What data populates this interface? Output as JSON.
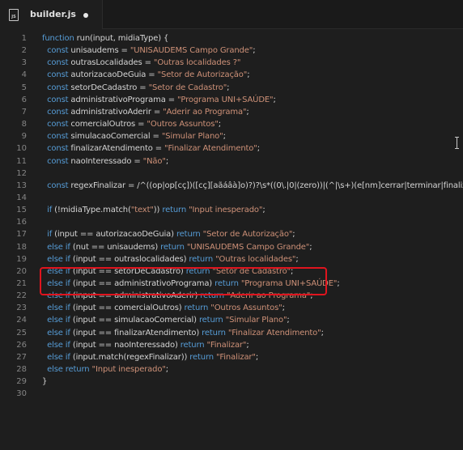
{
  "tab": {
    "title": "builder.js",
    "icon": "js-file-icon",
    "icon_text": "JS",
    "modified": true
  },
  "colors": {
    "keyword": "#569cd6",
    "string": "#ce9178",
    "text": "#d4d4d4",
    "line_number": "#858585",
    "highlight": "#e0141e"
  },
  "lines": [
    {
      "n": "1",
      "parts": [
        [
          "k",
          "function"
        ],
        [
          "v",
          " run(input, midiaType) {"
        ]
      ]
    },
    {
      "n": "2",
      "parts": [
        [
          "v",
          "  "
        ],
        [
          "k",
          "const"
        ],
        [
          "v",
          " unisaudems = "
        ],
        [
          "s",
          "\"UNISAUDEMS Campo Grande\""
        ],
        [
          "v",
          ";"
        ]
      ]
    },
    {
      "n": "3",
      "parts": [
        [
          "v",
          "  "
        ],
        [
          "k",
          "const"
        ],
        [
          "v",
          " outrasLocalidades = "
        ],
        [
          "s",
          "\"Outras localidades ?\""
        ]
      ]
    },
    {
      "n": "4",
      "parts": [
        [
          "v",
          "  "
        ],
        [
          "k",
          "const"
        ],
        [
          "v",
          " autorizacaoDeGuia = "
        ],
        [
          "s",
          "\"Setor de Autorização\""
        ],
        [
          "v",
          ";"
        ]
      ]
    },
    {
      "n": "5",
      "parts": [
        [
          "v",
          "  "
        ],
        [
          "k",
          "const"
        ],
        [
          "v",
          " setorDeCadastro = "
        ],
        [
          "s",
          "\"Setor de Cadastro\""
        ],
        [
          "v",
          ";"
        ]
      ]
    },
    {
      "n": "6",
      "parts": [
        [
          "v",
          "  "
        ],
        [
          "k",
          "const"
        ],
        [
          "v",
          " administrativoPrograma = "
        ],
        [
          "s",
          "\"Programa UNI+SAÚDE\""
        ],
        [
          "v",
          ";"
        ]
      ]
    },
    {
      "n": "7",
      "parts": [
        [
          "v",
          "  "
        ],
        [
          "k",
          "const"
        ],
        [
          "v",
          " administrativoAderir = "
        ],
        [
          "s",
          "\"Aderir ao Programa\""
        ],
        [
          "v",
          ";"
        ]
      ]
    },
    {
      "n": "8",
      "parts": [
        [
          "v",
          "  "
        ],
        [
          "k",
          "const"
        ],
        [
          "v",
          " comercialOutros = "
        ],
        [
          "s",
          "\"Outros Assuntos\""
        ],
        [
          "v",
          ";"
        ]
      ]
    },
    {
      "n": "9",
      "parts": [
        [
          "v",
          "  "
        ],
        [
          "k",
          "const"
        ],
        [
          "v",
          " simulacaoComercial = "
        ],
        [
          "s",
          "\"Simular Plano\""
        ],
        [
          "v",
          ";"
        ]
      ]
    },
    {
      "n": "10",
      "parts": [
        [
          "v",
          "  "
        ],
        [
          "k",
          "const"
        ],
        [
          "v",
          " finalizarAtendimento = "
        ],
        [
          "s",
          "\"Finalizar Atendimento\""
        ],
        [
          "v",
          ";"
        ]
      ]
    },
    {
      "n": "11",
      "parts": [
        [
          "v",
          "  "
        ],
        [
          "k",
          "const"
        ],
        [
          "v",
          " naoInteressado = "
        ],
        [
          "s",
          "\"Não\""
        ],
        [
          "v",
          ";"
        ]
      ]
    },
    {
      "n": "12",
      "parts": []
    },
    {
      "n": "13",
      "parts": [
        [
          "v",
          "  "
        ],
        [
          "k",
          "const"
        ],
        [
          "v",
          " regexFinalizar = /^((op|op[cç])([cç][aãáâà]o)?)?\\s*((0\\.|0|(zero))|(^|\\s+)(e[nm]cerrar|terminar|finaliz"
        ]
      ]
    },
    {
      "n": "14",
      "parts": []
    },
    {
      "n": "15",
      "parts": [
        [
          "v",
          "  "
        ],
        [
          "k",
          "if"
        ],
        [
          "v",
          " (!midiaType.match("
        ],
        [
          "s",
          "\"text\""
        ],
        [
          "v",
          ")) "
        ],
        [
          "k",
          "return"
        ],
        [
          "v",
          " "
        ],
        [
          "s",
          "\"Input inesperado\""
        ],
        [
          "v",
          ";"
        ]
      ]
    },
    {
      "n": "16",
      "parts": []
    },
    {
      "n": "17",
      "parts": [
        [
          "v",
          "  "
        ],
        [
          "k",
          "if"
        ],
        [
          "v",
          " (input == autorizacaoDeGuia) "
        ],
        [
          "k",
          "return"
        ],
        [
          "v",
          " "
        ],
        [
          "s",
          "\"Setor de Autorização\""
        ],
        [
          "v",
          ";"
        ]
      ]
    },
    {
      "n": "18",
      "parts": [
        [
          "v",
          "  "
        ],
        [
          "k",
          "else if"
        ],
        [
          "v",
          " (nut == unisaudems) "
        ],
        [
          "k",
          "return"
        ],
        [
          "v",
          " "
        ],
        [
          "s",
          "\"UNISAUDEMS Campo Grande\""
        ],
        [
          "v",
          ";"
        ]
      ]
    },
    {
      "n": "19",
      "parts": [
        [
          "v",
          "  "
        ],
        [
          "k",
          "else if"
        ],
        [
          "v",
          " (input == outraslocalidades) "
        ],
        [
          "k",
          "return"
        ],
        [
          "v",
          " "
        ],
        [
          "s",
          "\"Outras localidades\""
        ],
        [
          "v",
          ";"
        ]
      ]
    },
    {
      "n": "20",
      "parts": [
        [
          "v",
          "  "
        ],
        [
          "k",
          "else if"
        ],
        [
          "v",
          " (input == setorDeCadastro) "
        ],
        [
          "k",
          "return"
        ],
        [
          "v",
          " "
        ],
        [
          "s",
          "\"Setor de Cadastro\""
        ],
        [
          "v",
          ";"
        ]
      ]
    },
    {
      "n": "21",
      "parts": [
        [
          "v",
          "  "
        ],
        [
          "k",
          "else if"
        ],
        [
          "v",
          " (input == administrativoPrograma) "
        ],
        [
          "k",
          "return"
        ],
        [
          "v",
          " "
        ],
        [
          "s",
          "\"Programa UNI+SAÚDE\""
        ],
        [
          "v",
          ";"
        ]
      ]
    },
    {
      "n": "22",
      "parts": [
        [
          "v",
          "  "
        ],
        [
          "k",
          "else if"
        ],
        [
          "v",
          " (input == administrativoAderir) "
        ],
        [
          "k",
          "return"
        ],
        [
          "v",
          " "
        ],
        [
          "s",
          "\"Aderir ao Programa\""
        ],
        [
          "v",
          ";"
        ]
      ]
    },
    {
      "n": "23",
      "parts": [
        [
          "v",
          "  "
        ],
        [
          "k",
          "else if"
        ],
        [
          "v",
          " (input == comercialOutros) "
        ],
        [
          "k",
          "return"
        ],
        [
          "v",
          " "
        ],
        [
          "s",
          "\"Outros Assuntos\""
        ],
        [
          "v",
          ";"
        ]
      ]
    },
    {
      "n": "24",
      "parts": [
        [
          "v",
          "  "
        ],
        [
          "k",
          "else if"
        ],
        [
          "v",
          " (input == simulacaoComercial) "
        ],
        [
          "k",
          "return"
        ],
        [
          "v",
          " "
        ],
        [
          "s",
          "\"Simular Plano\""
        ],
        [
          "v",
          ";"
        ]
      ]
    },
    {
      "n": "25",
      "parts": [
        [
          "v",
          "  "
        ],
        [
          "k",
          "else if"
        ],
        [
          "v",
          " (input == finalizarAtendimento) "
        ],
        [
          "k",
          "return"
        ],
        [
          "v",
          " "
        ],
        [
          "s",
          "\"Finalizar Atendimento\""
        ],
        [
          "v",
          ";"
        ]
      ]
    },
    {
      "n": "26",
      "parts": [
        [
          "v",
          "  "
        ],
        [
          "k",
          "else if"
        ],
        [
          "v",
          " (input == naoInteressado) "
        ],
        [
          "k",
          "return"
        ],
        [
          "v",
          " "
        ],
        [
          "s",
          "\"Finalizar\""
        ],
        [
          "v",
          ";"
        ]
      ]
    },
    {
      "n": "27",
      "parts": [
        [
          "v",
          "  "
        ],
        [
          "k",
          "else if"
        ],
        [
          "v",
          " (input.match(regexFinalizar)) "
        ],
        [
          "k",
          "return"
        ],
        [
          "v",
          " "
        ],
        [
          "s",
          "\"Finalizar\""
        ],
        [
          "v",
          ";"
        ]
      ]
    },
    {
      "n": "28",
      "parts": [
        [
          "v",
          "  "
        ],
        [
          "k",
          "else"
        ],
        [
          "v",
          " "
        ],
        [
          "k",
          "return"
        ],
        [
          "v",
          " "
        ],
        [
          "s",
          "\"Input inesperado\""
        ],
        [
          "v",
          ";"
        ]
      ]
    },
    {
      "n": "29",
      "parts": [
        [
          "v",
          "}"
        ]
      ]
    },
    {
      "n": "30",
      "parts": []
    }
  ]
}
